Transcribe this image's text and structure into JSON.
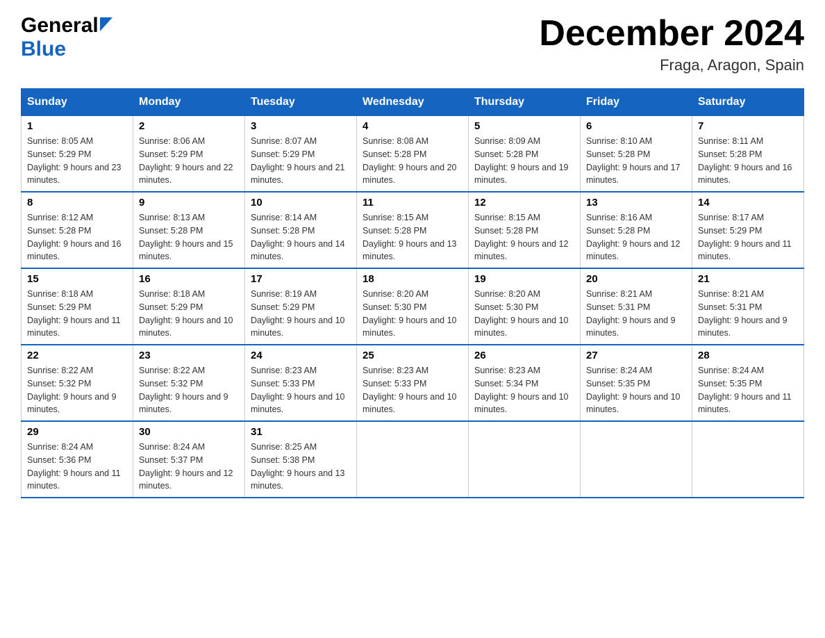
{
  "header": {
    "logo_general": "General",
    "logo_blue": "Blue",
    "title": "December 2024",
    "location": "Fraga, Aragon, Spain"
  },
  "calendar": {
    "days": [
      "Sunday",
      "Monday",
      "Tuesday",
      "Wednesday",
      "Thursday",
      "Friday",
      "Saturday"
    ],
    "weeks": [
      [
        {
          "day": "1",
          "sunrise": "8:05 AM",
          "sunset": "5:29 PM",
          "daylight": "9 hours and 23 minutes."
        },
        {
          "day": "2",
          "sunrise": "8:06 AM",
          "sunset": "5:29 PM",
          "daylight": "9 hours and 22 minutes."
        },
        {
          "day": "3",
          "sunrise": "8:07 AM",
          "sunset": "5:29 PM",
          "daylight": "9 hours and 21 minutes."
        },
        {
          "day": "4",
          "sunrise": "8:08 AM",
          "sunset": "5:28 PM",
          "daylight": "9 hours and 20 minutes."
        },
        {
          "day": "5",
          "sunrise": "8:09 AM",
          "sunset": "5:28 PM",
          "daylight": "9 hours and 19 minutes."
        },
        {
          "day": "6",
          "sunrise": "8:10 AM",
          "sunset": "5:28 PM",
          "daylight": "9 hours and 17 minutes."
        },
        {
          "day": "7",
          "sunrise": "8:11 AM",
          "sunset": "5:28 PM",
          "daylight": "9 hours and 16 minutes."
        }
      ],
      [
        {
          "day": "8",
          "sunrise": "8:12 AM",
          "sunset": "5:28 PM",
          "daylight": "9 hours and 16 minutes."
        },
        {
          "day": "9",
          "sunrise": "8:13 AM",
          "sunset": "5:28 PM",
          "daylight": "9 hours and 15 minutes."
        },
        {
          "day": "10",
          "sunrise": "8:14 AM",
          "sunset": "5:28 PM",
          "daylight": "9 hours and 14 minutes."
        },
        {
          "day": "11",
          "sunrise": "8:15 AM",
          "sunset": "5:28 PM",
          "daylight": "9 hours and 13 minutes."
        },
        {
          "day": "12",
          "sunrise": "8:15 AM",
          "sunset": "5:28 PM",
          "daylight": "9 hours and 12 minutes."
        },
        {
          "day": "13",
          "sunrise": "8:16 AM",
          "sunset": "5:28 PM",
          "daylight": "9 hours and 12 minutes."
        },
        {
          "day": "14",
          "sunrise": "8:17 AM",
          "sunset": "5:29 PM",
          "daylight": "9 hours and 11 minutes."
        }
      ],
      [
        {
          "day": "15",
          "sunrise": "8:18 AM",
          "sunset": "5:29 PM",
          "daylight": "9 hours and 11 minutes."
        },
        {
          "day": "16",
          "sunrise": "8:18 AM",
          "sunset": "5:29 PM",
          "daylight": "9 hours and 10 minutes."
        },
        {
          "day": "17",
          "sunrise": "8:19 AM",
          "sunset": "5:29 PM",
          "daylight": "9 hours and 10 minutes."
        },
        {
          "day": "18",
          "sunrise": "8:20 AM",
          "sunset": "5:30 PM",
          "daylight": "9 hours and 10 minutes."
        },
        {
          "day": "19",
          "sunrise": "8:20 AM",
          "sunset": "5:30 PM",
          "daylight": "9 hours and 10 minutes."
        },
        {
          "day": "20",
          "sunrise": "8:21 AM",
          "sunset": "5:31 PM",
          "daylight": "9 hours and 9 minutes."
        },
        {
          "day": "21",
          "sunrise": "8:21 AM",
          "sunset": "5:31 PM",
          "daylight": "9 hours and 9 minutes."
        }
      ],
      [
        {
          "day": "22",
          "sunrise": "8:22 AM",
          "sunset": "5:32 PM",
          "daylight": "9 hours and 9 minutes."
        },
        {
          "day": "23",
          "sunrise": "8:22 AM",
          "sunset": "5:32 PM",
          "daylight": "9 hours and 9 minutes."
        },
        {
          "day": "24",
          "sunrise": "8:23 AM",
          "sunset": "5:33 PM",
          "daylight": "9 hours and 10 minutes."
        },
        {
          "day": "25",
          "sunrise": "8:23 AM",
          "sunset": "5:33 PM",
          "daylight": "9 hours and 10 minutes."
        },
        {
          "day": "26",
          "sunrise": "8:23 AM",
          "sunset": "5:34 PM",
          "daylight": "9 hours and 10 minutes."
        },
        {
          "day": "27",
          "sunrise": "8:24 AM",
          "sunset": "5:35 PM",
          "daylight": "9 hours and 10 minutes."
        },
        {
          "day": "28",
          "sunrise": "8:24 AM",
          "sunset": "5:35 PM",
          "daylight": "9 hours and 11 minutes."
        }
      ],
      [
        {
          "day": "29",
          "sunrise": "8:24 AM",
          "sunset": "5:36 PM",
          "daylight": "9 hours and 11 minutes."
        },
        {
          "day": "30",
          "sunrise": "8:24 AM",
          "sunset": "5:37 PM",
          "daylight": "9 hours and 12 minutes."
        },
        {
          "day": "31",
          "sunrise": "8:25 AM",
          "sunset": "5:38 PM",
          "daylight": "9 hours and 13 minutes."
        },
        null,
        null,
        null,
        null
      ]
    ]
  }
}
